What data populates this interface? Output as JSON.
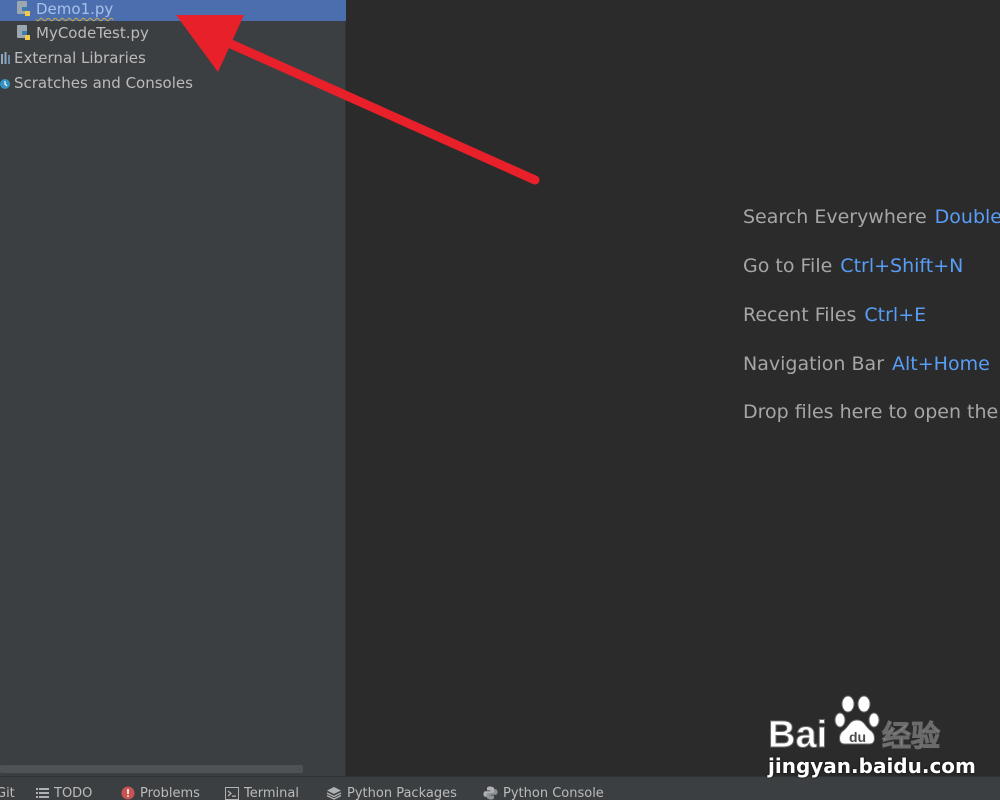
{
  "project_tree": {
    "items": [
      {
        "label": "Demo1.py",
        "icon": "python-file-icon",
        "selected": true
      },
      {
        "label": "MyCodeTest.py",
        "icon": "python-file-icon",
        "selected": false
      },
      {
        "label": "External Libraries",
        "icon": "library-icon",
        "selected": false
      },
      {
        "label": "Scratches and Consoles",
        "icon": "scratch-icon",
        "selected": false
      }
    ]
  },
  "editor": {
    "hints": [
      {
        "text": "Search Everywhere",
        "shortcut": "Double"
      },
      {
        "text": "Go to File",
        "shortcut": "Ctrl+Shift+N"
      },
      {
        "text": "Recent Files",
        "shortcut": "Ctrl+E"
      },
      {
        "text": "Navigation Bar",
        "shortcut": "Alt+Home"
      },
      {
        "text": "Drop files here to open the",
        "shortcut": ""
      }
    ]
  },
  "bottom_bar": {
    "tools": [
      {
        "label": "Git",
        "icon": "git-icon"
      },
      {
        "label": "TODO",
        "icon": "list-icon"
      },
      {
        "label": "Problems",
        "icon": "error-icon"
      },
      {
        "label": "Terminal",
        "icon": "terminal-icon"
      },
      {
        "label": "Python Packages",
        "icon": "layers-icon"
      },
      {
        "label": "Python Console",
        "icon": "python-icon"
      }
    ]
  },
  "watermark": {
    "brand": "Bai 经验",
    "url": "jingyan.baidu.com"
  },
  "colors": {
    "selection": "#4b6eaf",
    "shortcut": "#589df6",
    "arrow": "#e8202a"
  }
}
